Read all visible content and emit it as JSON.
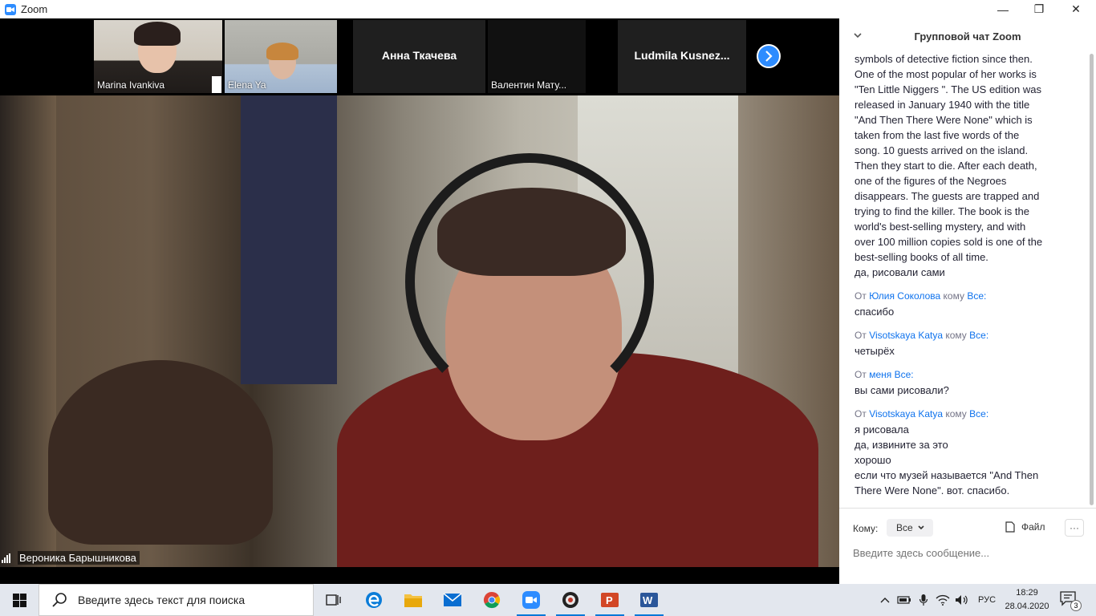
{
  "window": {
    "title": "Zoom",
    "minimize_glyph": "—",
    "maximize_glyph": "❐",
    "close_glyph": "✕"
  },
  "participants": [
    {
      "name": "Marina Ivankiva",
      "has_video": true
    },
    {
      "name": "Elena Ya",
      "has_video": true
    },
    {
      "name": "Анна Ткачева",
      "has_video": false
    },
    {
      "name": "Валентин Мату...",
      "has_video": false
    },
    {
      "name": "Ludmila  Kusnez...",
      "has_video": false
    }
  ],
  "active_speaker": {
    "name": "Вероника Барышникова"
  },
  "chat": {
    "title": "Групповой чат Zoom",
    "lines_top": [
      "symbols of detective fiction since then.",
      "One of the most popular of her works is",
      "\"Ten Little Niggers \". The US edition was",
      "released in January 1940 with the title",
      "\"And Then There Were None\" which is",
      "taken from the last five words of the",
      "song. 10 guests arrived on the island.",
      "Then they start to die. After each death,",
      "one of the figures of the Negroes",
      "disappears. The guests are trapped and",
      "trying to find the killer. The book is the",
      "world's best-selling mystery, and with",
      "over 100 million copies sold is one of the",
      "best-selling books of all time.",
      "да, рисовали сами"
    ],
    "messages": [
      {
        "from_label": "От",
        "sender": "Юлия Соколова",
        "to_label": "кому",
        "recipient": "Все:",
        "lines": [
          "спасибо"
        ]
      },
      {
        "from_label": "От",
        "sender": "Visotskaya Katya",
        "to_label": "кому",
        "recipient": "Все:",
        "lines": [
          "четырёх"
        ]
      },
      {
        "from_label": "От",
        "sender": "меня",
        "to_label": "",
        "recipient": "Все:",
        "lines": [
          "вы сами рисовали?"
        ]
      },
      {
        "from_label": "От",
        "sender": "Visotskaya Katya",
        "to_label": "кому",
        "recipient": "Все:",
        "lines": [
          "я рисовала",
          "да, извините за это",
          "хорошо",
          "если что музей называется \"And Then",
          "There Were None\". вот. спасибо."
        ]
      }
    ],
    "to_label": "Кому:",
    "to_value": "Все",
    "file_label": "Файл",
    "more_glyph": "···",
    "input_placeholder": "Введите здесь сообщение..."
  },
  "taskbar": {
    "search_placeholder": "Введите здесь текст для поиска",
    "apps": [
      "task-view",
      "edge",
      "file-explorer",
      "mail",
      "chrome",
      "zoom",
      "media-player",
      "powerpoint",
      "word"
    ],
    "language": "РУС",
    "time": "18:29",
    "date": "28.04.2020",
    "notifications": "3"
  },
  "colors": {
    "accent": "#2d8cff",
    "link": "#0e72ed",
    "taskbar": "#e3e7ee"
  }
}
